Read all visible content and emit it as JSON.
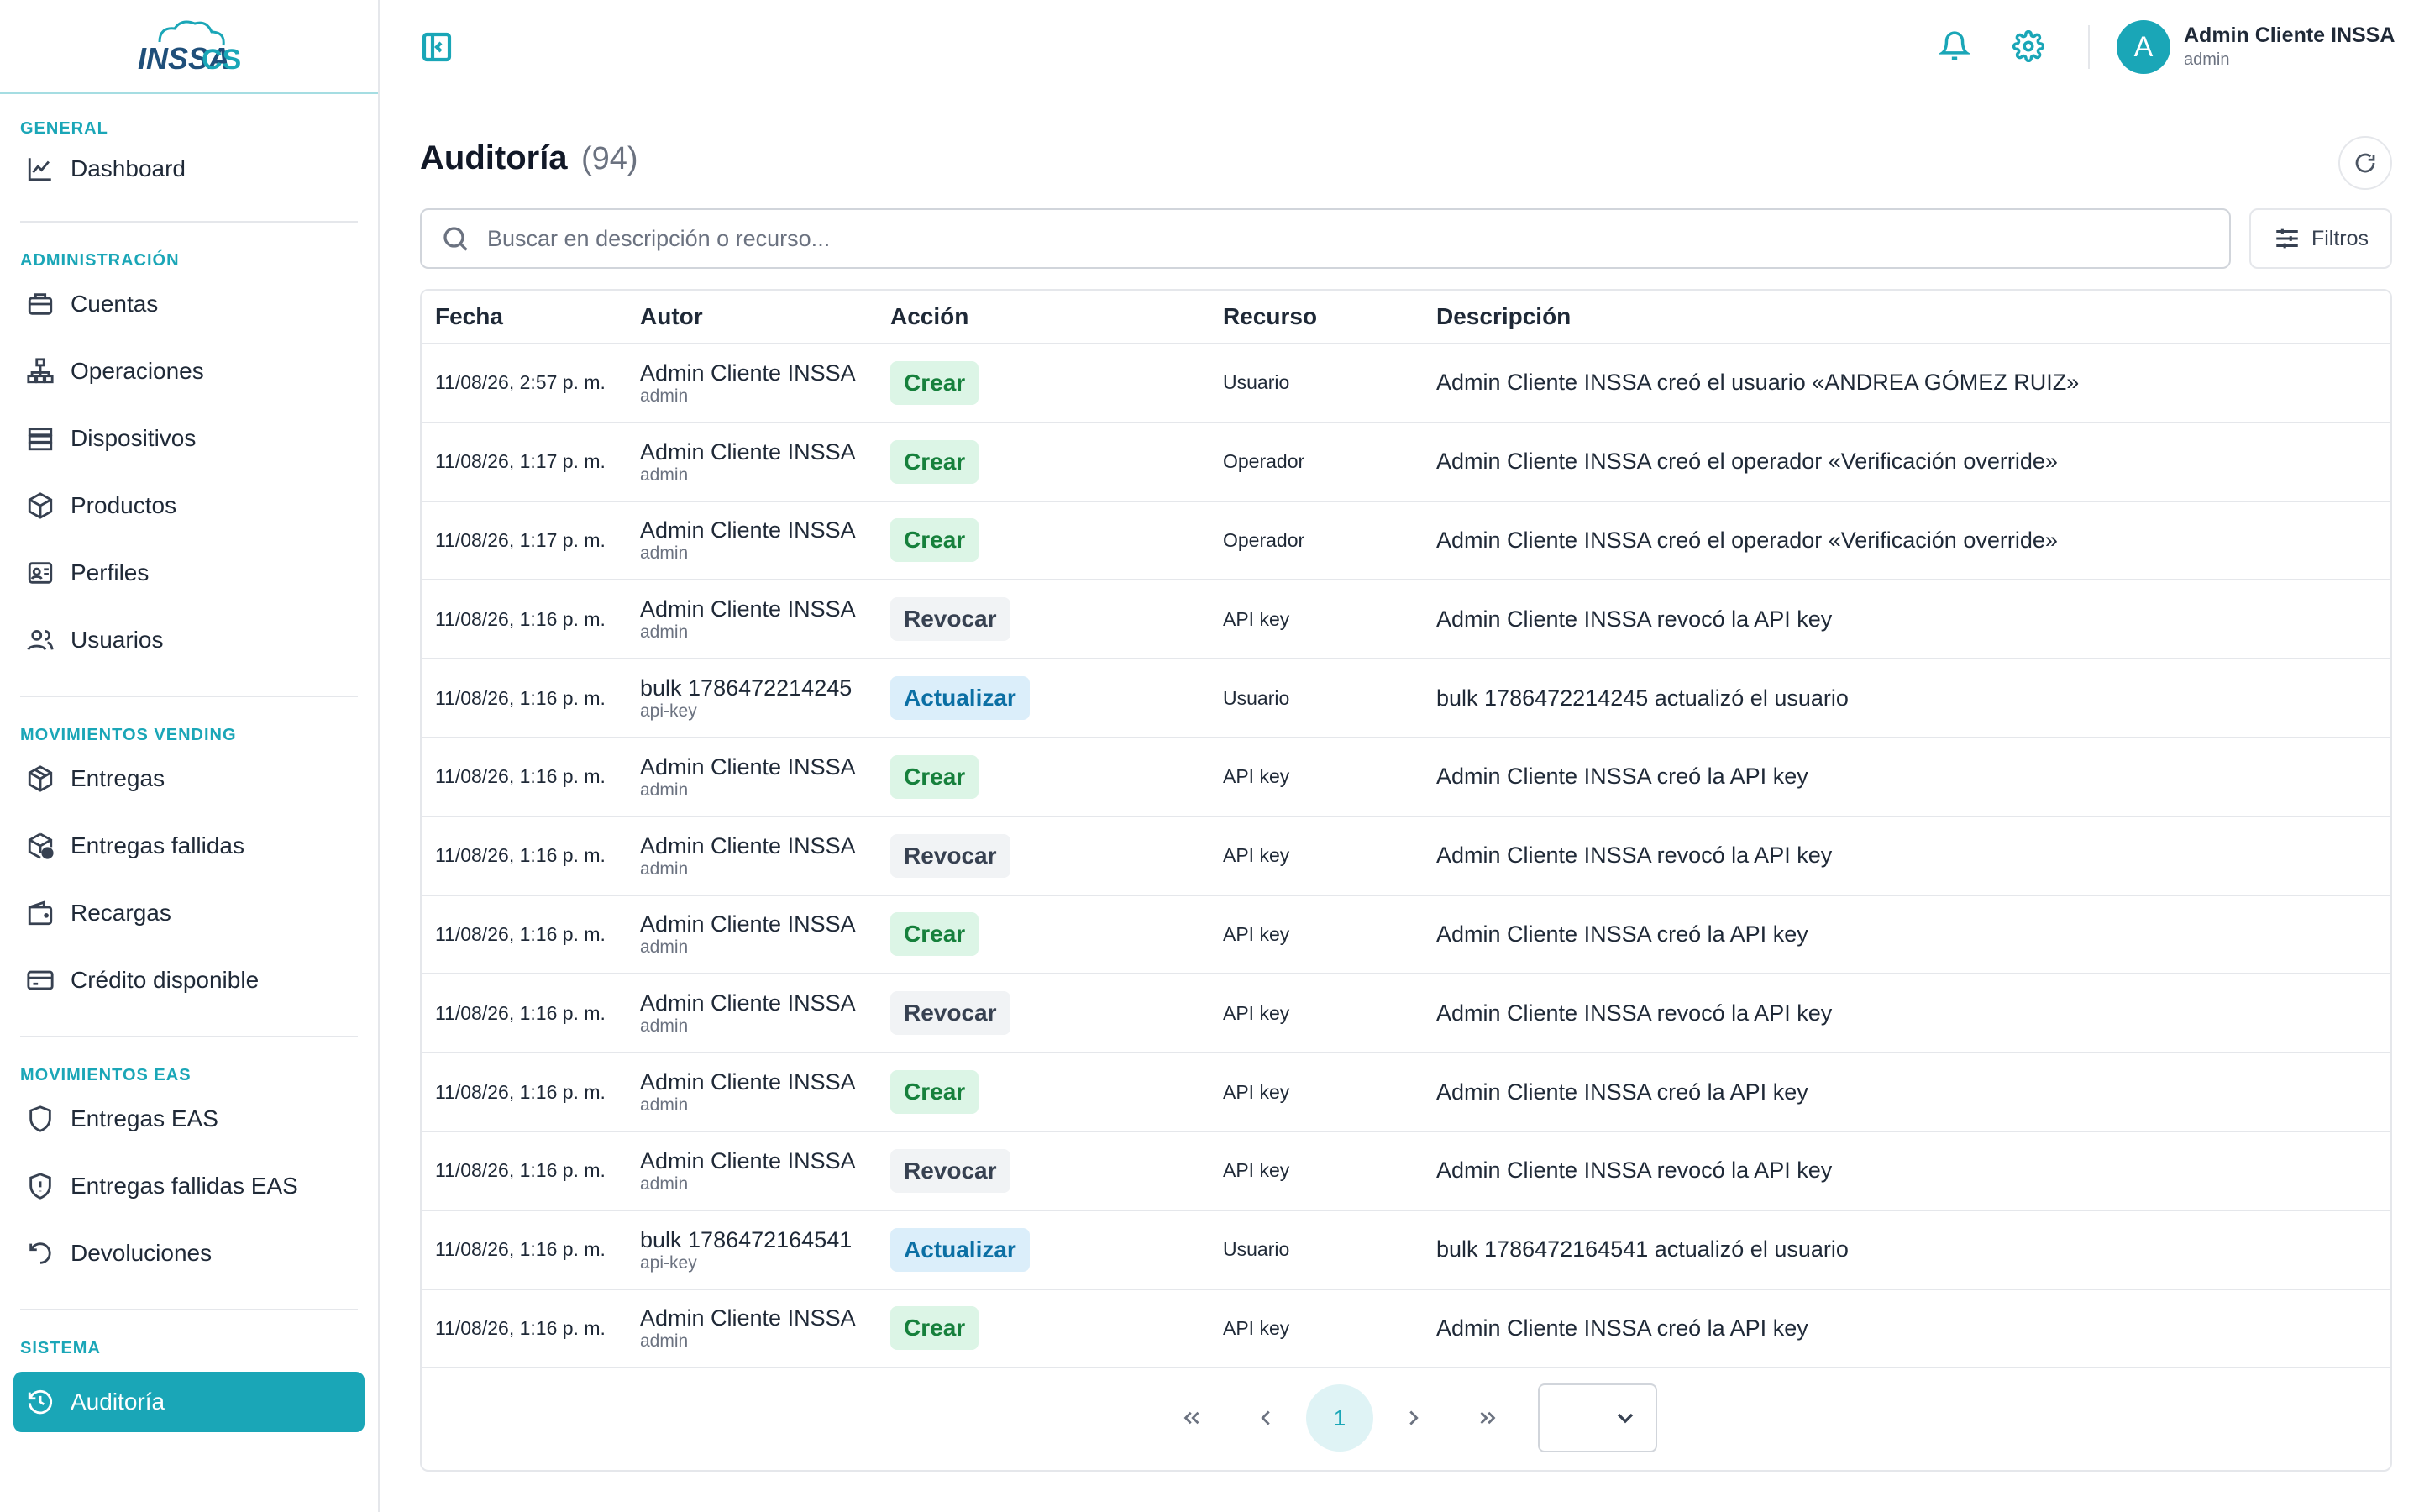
{
  "brand": {
    "logo_text": "INSSA CS",
    "accent": "#1aa6b7"
  },
  "sidebar": {
    "sections": [
      {
        "label": "GENERAL",
        "items": [
          {
            "label": "Dashboard",
            "icon": "chart-line-icon"
          }
        ]
      },
      {
        "label": "ADMINISTRACIÓN",
        "items": [
          {
            "label": "Cuentas",
            "icon": "briefcase-icon"
          },
          {
            "label": "Operaciones",
            "icon": "org-chart-icon"
          },
          {
            "label": "Dispositivos",
            "icon": "server-icon"
          },
          {
            "label": "Productos",
            "icon": "box-icon"
          },
          {
            "label": "Perfiles",
            "icon": "id-card-icon"
          },
          {
            "label": "Usuarios",
            "icon": "users-icon"
          }
        ]
      },
      {
        "label": "MOVIMIENTOS VENDING",
        "items": [
          {
            "label": "Entregas",
            "icon": "package-icon"
          },
          {
            "label": "Entregas fallidas",
            "icon": "package-error-icon"
          },
          {
            "label": "Recargas",
            "icon": "wallet-icon"
          },
          {
            "label": "Crédito disponible",
            "icon": "credit-card-icon"
          }
        ]
      },
      {
        "label": "MOVIMIENTOS EAS",
        "items": [
          {
            "label": "Entregas EAS",
            "icon": "shield-icon"
          },
          {
            "label": "Entregas fallidas EAS",
            "icon": "shield-alert-icon"
          },
          {
            "label": "Devoluciones",
            "icon": "undo-icon"
          }
        ]
      },
      {
        "label": "SISTEMA",
        "items": [
          {
            "label": "Auditoría",
            "icon": "history-icon",
            "active": true
          }
        ]
      }
    ]
  },
  "topbar": {
    "user_name": "Admin Cliente INSSA",
    "user_role": "admin",
    "avatar_initial": "A"
  },
  "main": {
    "title": "Auditoría",
    "count": "(94)",
    "search_placeholder": "Buscar en descripción o recurso...",
    "filters_label": "Filtros",
    "columns": [
      "Fecha",
      "Autor",
      "Acción",
      "Recurso",
      "Descripción"
    ],
    "rows": [
      {
        "fecha": "11/08/26, 2:57 p. m.",
        "autor": "Admin Cliente INSSA",
        "rol": "admin",
        "accion": "Crear",
        "tipo": "crear",
        "recurso": "Usuario",
        "descripcion": "Admin Cliente INSSA creó el usuario «ANDREA GÓMEZ RUIZ»"
      },
      {
        "fecha": "11/08/26, 1:17 p. m.",
        "autor": "Admin Cliente INSSA",
        "rol": "admin",
        "accion": "Crear",
        "tipo": "crear",
        "recurso": "Operador",
        "descripcion": "Admin Cliente INSSA creó el operador «Verificación override»"
      },
      {
        "fecha": "11/08/26, 1:17 p. m.",
        "autor": "Admin Cliente INSSA",
        "rol": "admin",
        "accion": "Crear",
        "tipo": "crear",
        "recurso": "Operador",
        "descripcion": "Admin Cliente INSSA creó el operador «Verificación override»"
      },
      {
        "fecha": "11/08/26, 1:16 p. m.",
        "autor": "Admin Cliente INSSA",
        "rol": "admin",
        "accion": "Revocar",
        "tipo": "revocar",
        "recurso": "API key",
        "descripcion": "Admin Cliente INSSA revocó la API key"
      },
      {
        "fecha": "11/08/26, 1:16 p. m.",
        "autor": "bulk 1786472214245",
        "rol": "api-key",
        "accion": "Actualizar",
        "tipo": "actualizar",
        "recurso": "Usuario",
        "descripcion": "bulk 1786472214245 actualizó el usuario"
      },
      {
        "fecha": "11/08/26, 1:16 p. m.",
        "autor": "Admin Cliente INSSA",
        "rol": "admin",
        "accion": "Crear",
        "tipo": "crear",
        "recurso": "API key",
        "descripcion": "Admin Cliente INSSA creó la API key"
      },
      {
        "fecha": "11/08/26, 1:16 p. m.",
        "autor": "Admin Cliente INSSA",
        "rol": "admin",
        "accion": "Revocar",
        "tipo": "revocar",
        "recurso": "API key",
        "descripcion": "Admin Cliente INSSA revocó la API key"
      },
      {
        "fecha": "11/08/26, 1:16 p. m.",
        "autor": "Admin Cliente INSSA",
        "rol": "admin",
        "accion": "Crear",
        "tipo": "crear",
        "recurso": "API key",
        "descripcion": "Admin Cliente INSSA creó la API key"
      },
      {
        "fecha": "11/08/26, 1:16 p. m.",
        "autor": "Admin Cliente INSSA",
        "rol": "admin",
        "accion": "Revocar",
        "tipo": "revocar",
        "recurso": "API key",
        "descripcion": "Admin Cliente INSSA revocó la API key"
      },
      {
        "fecha": "11/08/26, 1:16 p. m.",
        "autor": "Admin Cliente INSSA",
        "rol": "admin",
        "accion": "Crear",
        "tipo": "crear",
        "recurso": "API key",
        "descripcion": "Admin Cliente INSSA creó la API key"
      },
      {
        "fecha": "11/08/26, 1:16 p. m.",
        "autor": "Admin Cliente INSSA",
        "rol": "admin",
        "accion": "Revocar",
        "tipo": "revocar",
        "recurso": "API key",
        "descripcion": "Admin Cliente INSSA revocó la API key"
      },
      {
        "fecha": "11/08/26, 1:16 p. m.",
        "autor": "bulk 1786472164541",
        "rol": "api-key",
        "accion": "Actualizar",
        "tipo": "actualizar",
        "recurso": "Usuario",
        "descripcion": "bulk 1786472164541 actualizó el usuario"
      },
      {
        "fecha": "11/08/26, 1:16 p. m.",
        "autor": "Admin Cliente INSSA",
        "rol": "admin",
        "accion": "Crear",
        "tipo": "crear",
        "recurso": "API key",
        "descripcion": "Admin Cliente INSSA creó la API key"
      }
    ],
    "pagination": {
      "current_page": "1",
      "page_size": ""
    }
  }
}
